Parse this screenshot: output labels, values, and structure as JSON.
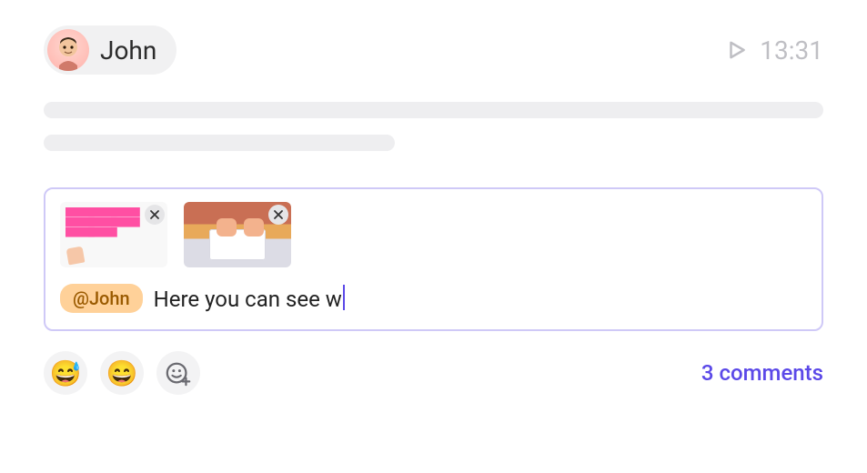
{
  "header": {
    "user_name": "John",
    "time": "13:31"
  },
  "compose": {
    "mention": "@John",
    "typed_text": "Here you can see w",
    "attachments": [
      {
        "name": "pink-sticky-notes-image"
      },
      {
        "name": "hands-on-keyboard-image"
      }
    ]
  },
  "reactions": {
    "emoji1": "😅",
    "emoji2": "😄"
  },
  "footer": {
    "comments_label": "3 comments"
  }
}
